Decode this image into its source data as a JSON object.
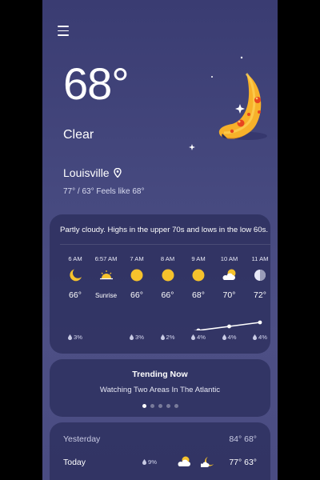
{
  "current": {
    "temperature": "68°",
    "condition": "Clear",
    "city": "Louisville",
    "feels_line": "77° / 63° Feels like 68°"
  },
  "forecast": {
    "summary": "Partly cloudy. Highs in the upper 70s and lows in the low 60s.",
    "hours": [
      {
        "time": "6 AM",
        "temp": "66°",
        "rain": "3%",
        "icon": "moon-icon",
        "tempNum": 66
      },
      {
        "time": "6:57 AM",
        "temp": "Sunrise",
        "rain": "",
        "icon": "sunrise-icon",
        "tempNum": null
      },
      {
        "time": "7 AM",
        "temp": "66°",
        "rain": "3%",
        "icon": "sun-icon",
        "tempNum": 66
      },
      {
        "time": "8 AM",
        "temp": "66°",
        "rain": "2%",
        "icon": "sun-icon",
        "tempNum": 66
      },
      {
        "time": "9 AM",
        "temp": "68°",
        "rain": "4%",
        "icon": "sun-icon",
        "tempNum": 68
      },
      {
        "time": "10 AM",
        "temp": "70°",
        "rain": "4%",
        "icon": "partly-cloudy-icon",
        "tempNum": 70
      },
      {
        "time": "11 AM",
        "temp": "72°",
        "rain": "4%",
        "icon": "partly-sunny-icon",
        "tempNum": 72
      }
    ]
  },
  "trending": {
    "title": "Trending Now",
    "subtitle": "Watching Two Areas In The Atlantic",
    "page_count": 5,
    "active_page": 0
  },
  "daily": {
    "yesterday": {
      "label": "Yesterday",
      "temps": "84° 68°"
    },
    "today": {
      "label": "Today",
      "rain": "9%",
      "temps": "77° 63°"
    }
  },
  "colors": {
    "accent_sun": "#f6c22c",
    "moon": "#f7b12a"
  }
}
